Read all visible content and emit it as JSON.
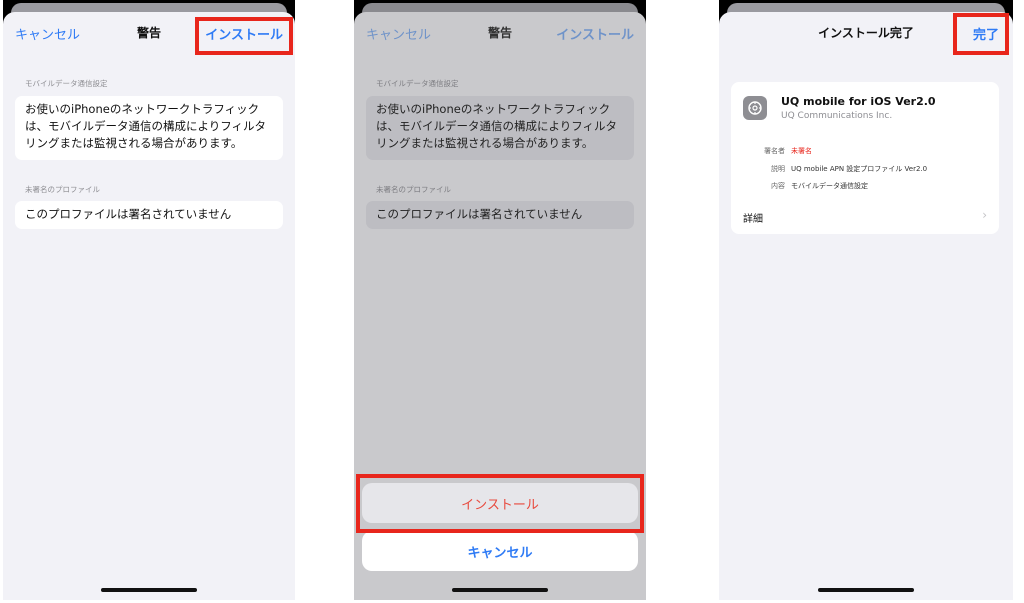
{
  "screen1": {
    "nav": {
      "cancel": "キャンセル",
      "title": "警告",
      "install": "インストール"
    },
    "section1_label": "モバイルデータ通信設定",
    "section1_text": "お使いのiPhoneのネットワークトラフィックは、モバイルデータ通信の構成によりフィルタリングまたは監視される場合があります。",
    "section2_label": "未署名のプロファイル",
    "section2_text": "このプロファイルは署名されていません"
  },
  "screen2": {
    "nav": {
      "cancel": "キャンセル",
      "title": "警告",
      "install": "インストール"
    },
    "section1_label": "モバイルデータ通信設定",
    "section1_text": "お使いのiPhoneのネットワークトラフィックは、モバイルデータ通信の構成によりフィルタリングまたは監視される場合があります。",
    "section2_label": "未署名のプロファイル",
    "section2_text": "このプロファイルは署名されていません",
    "action_install": "インストール",
    "action_cancel": "キャンセル"
  },
  "screen3": {
    "nav": {
      "title": "インストール完了",
      "done": "完了"
    },
    "profile_name": "UQ mobile for iOS Ver2.0",
    "profile_org": "UQ Communications Inc.",
    "rows": [
      {
        "key": "署名者",
        "value": "未署名"
      },
      {
        "key": "説明",
        "value": "UQ mobile APN 設定プロファイル Ver2.0"
      },
      {
        "key": "内容",
        "value": "モバイルデータ通信設定"
      }
    ],
    "detail_label": "詳細",
    "chevron": "›"
  },
  "colors": {
    "accent": "#2f7bf5",
    "highlight": "#e8261c",
    "destructive": "#e84a3e",
    "unsigned": "#e8261c"
  },
  "icons": {
    "profile": "gear-icon",
    "detail": "chevron-right-icon"
  }
}
